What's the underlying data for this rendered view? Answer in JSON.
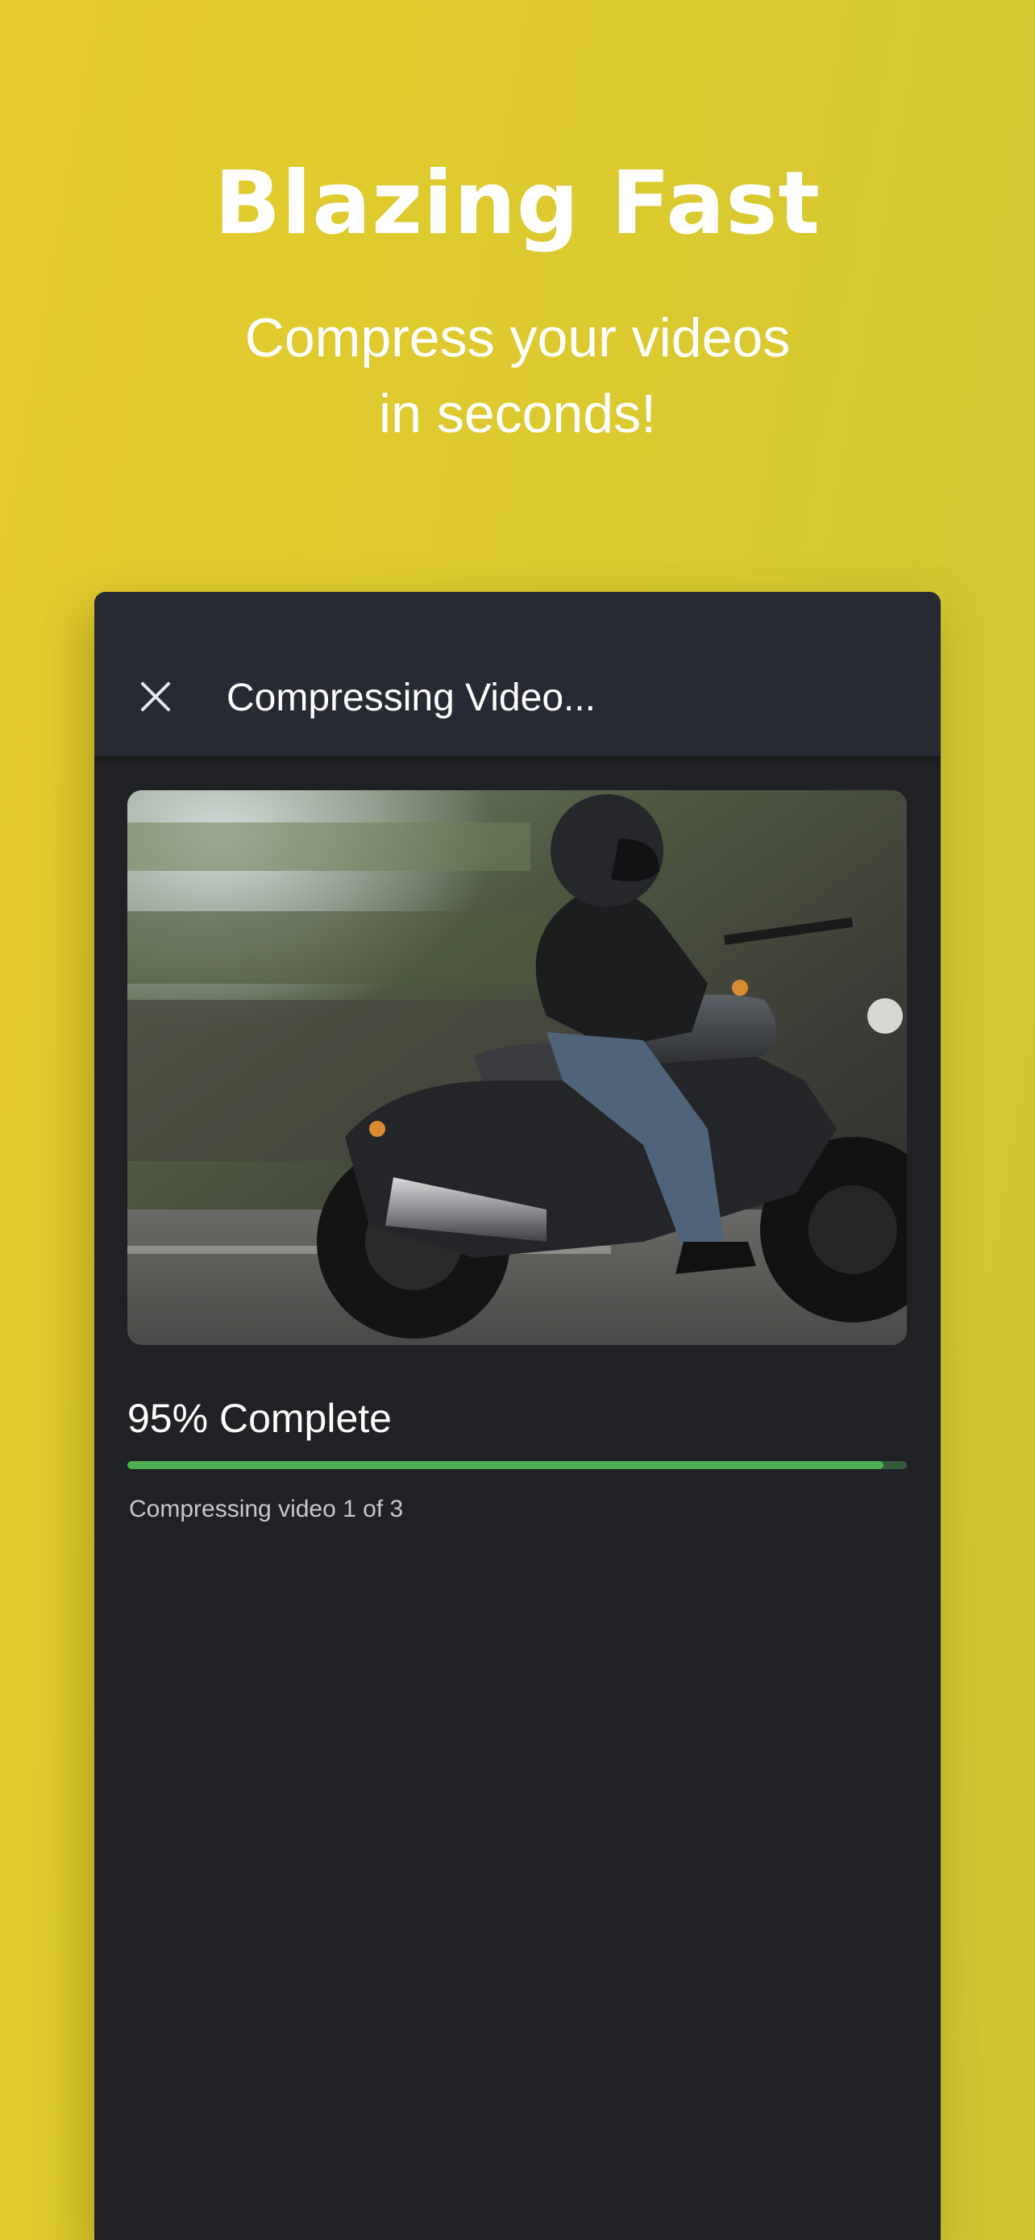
{
  "promo": {
    "headline": "Blazing Fast",
    "subhead_line1": "Compress your videos",
    "subhead_line2": "in seconds!"
  },
  "appbar": {
    "title": "Compressing Video...",
    "close_icon": "close-icon"
  },
  "video": {
    "thumbnail": "motorcycle-rider-image"
  },
  "progress": {
    "label": "95% Complete",
    "fraction": 0.97,
    "status": "Compressing video 1 of 3"
  },
  "colors": {
    "background": "#dcc92f",
    "card": "#202124",
    "appbar": "#282a33",
    "progress_fill": "#4caf50",
    "progress_track": "#355a3b"
  }
}
